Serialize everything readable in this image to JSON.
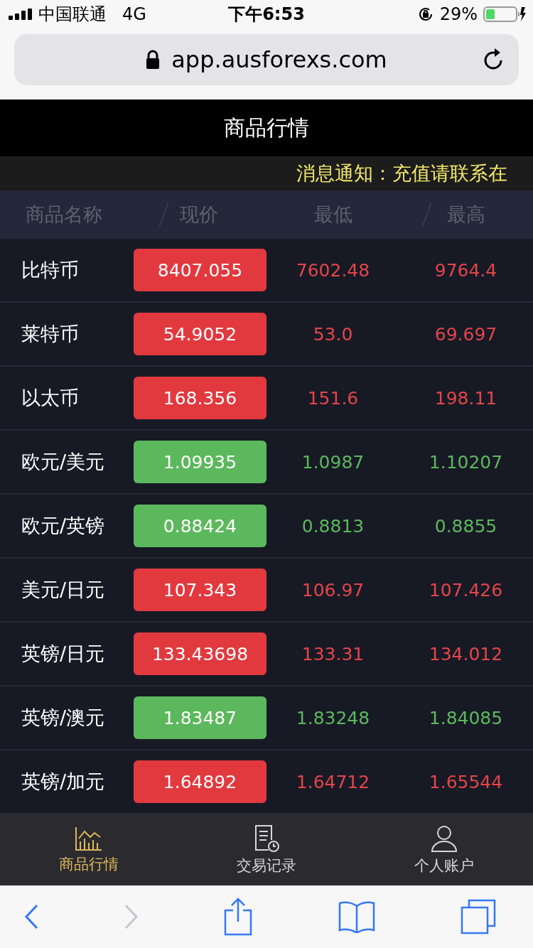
{
  "status_bar": {
    "carrier": "中国联通",
    "network": "4G",
    "time": "下午6:53",
    "battery": "29%"
  },
  "browser": {
    "url": "app.ausforexs.com"
  },
  "header": {
    "title": "商品行情"
  },
  "notice": "消息通知：充值请联系在",
  "table": {
    "columns": [
      "商品名称",
      "现价",
      "最低",
      "最高"
    ],
    "rows": [
      {
        "name": "比特币",
        "price": "8407.055",
        "low": "7602.48",
        "high": "9764.4",
        "kind": "up"
      },
      {
        "name": "莱特币",
        "price": "54.9052",
        "low": "53.0",
        "high": "69.697",
        "kind": "up"
      },
      {
        "name": "以太币",
        "price": "168.356",
        "low": "151.6",
        "high": "198.11",
        "kind": "up"
      },
      {
        "name": "欧元/美元",
        "price": "1.09935",
        "low": "1.0987",
        "high": "1.10207",
        "kind": "down"
      },
      {
        "name": "欧元/英镑",
        "price": "0.88424",
        "low": "0.8813",
        "high": "0.8855",
        "kind": "down"
      },
      {
        "name": "美元/日元",
        "price": "107.343",
        "low": "106.97",
        "high": "107.426",
        "kind": "up"
      },
      {
        "name": "英镑/日元",
        "price": "133.43698",
        "low": "133.31",
        "high": "134.012",
        "kind": "up"
      },
      {
        "name": "英镑/澳元",
        "price": "1.83487",
        "low": "1.83248",
        "high": "1.84085",
        "kind": "down"
      },
      {
        "name": "英镑/加元",
        "price": "1.64892",
        "low": "1.64712",
        "high": "1.65544",
        "kind": "up"
      }
    ]
  },
  "tab_bar": [
    {
      "label": "商品行情",
      "selected": true
    },
    {
      "label": "交易记录",
      "selected": false
    },
    {
      "label": "个人账户",
      "selected": false
    }
  ]
}
